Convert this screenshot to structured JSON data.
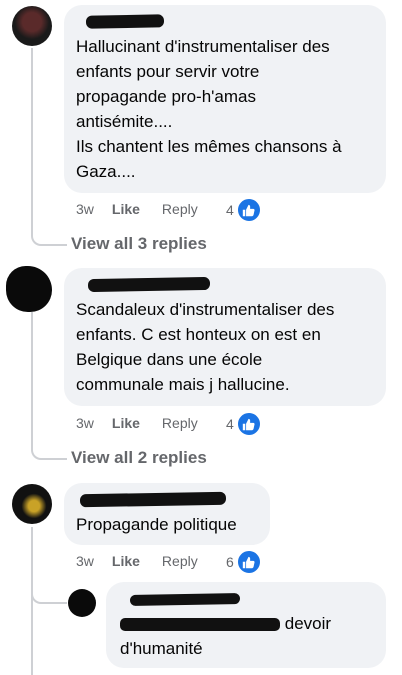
{
  "comments": [
    {
      "text": "Hallucinant d'instrumentaliser des\nenfants pour servir votre\npropagande pro-h'amas\nantisémite....\nIls chantent les mêmes chansons à\nGaza....",
      "time": "3w",
      "like_label": "Like",
      "reply_label": "Reply",
      "reactions": "4",
      "view_replies": "View all 3 replies"
    },
    {
      "text": "Scandaleux d'instrumentaliser des\nenfants. C est honteux on est en\nBelgique dans une école\ncommunale mais j hallucine.",
      "time": "3w",
      "like_label": "Like",
      "reply_label": "Reply",
      "reactions": "4",
      "view_replies": "View all 2 replies"
    },
    {
      "text": "Propagande politique",
      "time": "3w",
      "like_label": "Like",
      "reply_label": "Reply",
      "reactions": "6"
    }
  ],
  "reply": {
    "line1_tail": "devoir",
    "line2": "d'humanité"
  },
  "colors": {
    "like_badge": "#1b74e4",
    "bubble": "#f0f2f5",
    "meta": "#65676b"
  },
  "icons": {
    "reaction": "thumbs-up-icon"
  }
}
